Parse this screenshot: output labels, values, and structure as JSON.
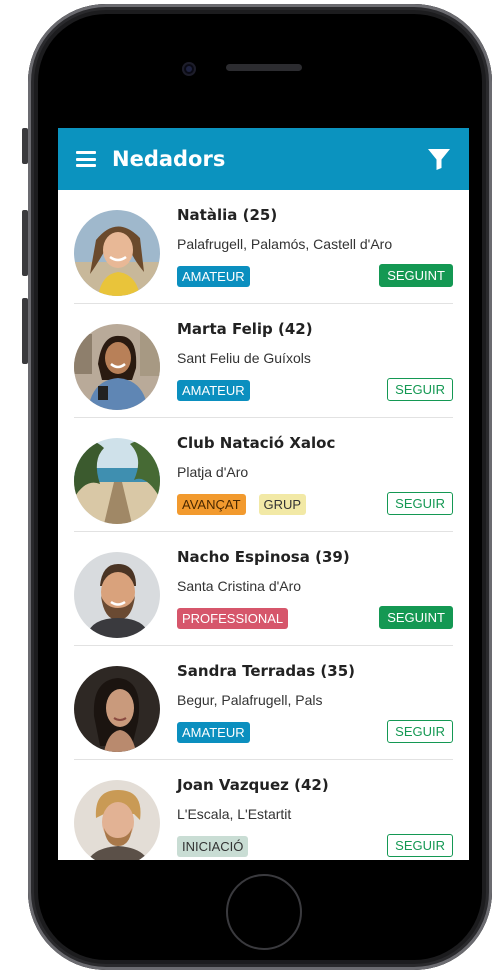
{
  "appbar": {
    "title": "Nedadors",
    "menu_icon": "hamburger-menu-icon",
    "filter_icon": "filter-funnel-icon",
    "color": "#0b93bf"
  },
  "swimmers": [
    {
      "name": "Natàlia (25)",
      "place": "Palafrugell, Palamós, Castell d'Aro",
      "badges": [
        {
          "label": "AMATEUR",
          "bg": "#0b8fbf",
          "fg": "#ffffff"
        }
      ],
      "follow": "SEGUINT",
      "following": true,
      "avatar": "woman-smiling-photo"
    },
    {
      "name": "Marta Felip (42)",
      "place": "Sant Feliu de Guíxols",
      "badges": [
        {
          "label": "AMATEUR",
          "bg": "#0b8fbf",
          "fg": "#ffffff"
        }
      ],
      "follow": "SEGUIR",
      "following": false,
      "avatar": "woman-denim-jacket-photo"
    },
    {
      "name": "Club Natació Xaloc",
      "place": "Platja d'Aro",
      "badges": [
        {
          "label": "AVANÇAT",
          "bg": "#f29a2e",
          "fg": "#4a2800"
        },
        {
          "label": "GRUP",
          "bg": "#f2e9a6",
          "fg": "#333333"
        }
      ],
      "follow": "SEGUIR",
      "following": false,
      "avatar": "beach-boardwalk-photo"
    },
    {
      "name": "Nacho Espinosa (39)",
      "place": "Santa Cristina d'Aro",
      "badges": [
        {
          "label": "PROFESSIONAL",
          "bg": "#d6566b",
          "fg": "#ffffff"
        }
      ],
      "follow": "SEGUINT",
      "following": true,
      "avatar": "bearded-man-photo"
    },
    {
      "name": "Sandra Terradas (35)",
      "place": "Begur, Palafrugell, Pals",
      "badges": [
        {
          "label": "AMATEUR",
          "bg": "#0b8fbf",
          "fg": "#ffffff"
        }
      ],
      "follow": "SEGUIR",
      "following": false,
      "avatar": "woman-dark-hair-photo"
    },
    {
      "name": "Joan Vazquez (42)",
      "place": "L'Escala, L'Estartit",
      "badges": [
        {
          "label": "INICIACIÓ",
          "bg": "#c9ddd4",
          "fg": "#333333"
        }
      ],
      "follow": "SEGUIR",
      "following": false,
      "avatar": "blond-man-photo"
    }
  ]
}
